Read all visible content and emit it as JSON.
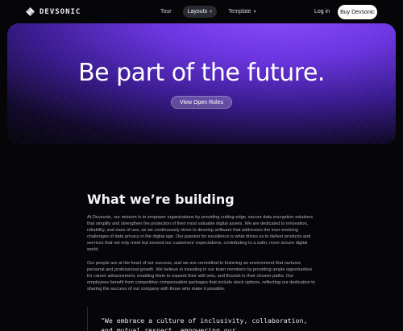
{
  "brand": {
    "name": "DEVSONIC",
    "logo_icon": "pinwheel-logo-icon"
  },
  "nav": {
    "items": [
      {
        "label": "Tour"
      },
      {
        "label": "Layouts",
        "has_dropdown": true,
        "active": true
      },
      {
        "label": "Template",
        "has_dropdown": true
      }
    ],
    "login_label": "Log in",
    "cta_label": "Buy Devsonic"
  },
  "hero": {
    "title": "Be part of the future.",
    "button_label": "View Open Roles",
    "accent_color": "#7b3ff2"
  },
  "section": {
    "title": "What we’re building",
    "paragraphs": [
      "At Devsonic, our mission is to empower organizations by providing cutting-edge, secure data encryption solutions that simplify and strengthen the protection of their most valuable digital assets. We are dedicated to innovation, reliability, and ease of use, as we continuously strive to develop software that addresses the ever-evolving challenges of data privacy in the digital age. Our passion for excellence is what drives us to deliver products and services that not only meet but exceed our customers’ expectations, contributing to a safer, more secure digital world.",
      "Our people are at the heart of our success, and we are committed to fostering an environment that nurtures personal and professional growth. We believe in investing in our team members by providing ample opportunities for career advancement, enabling them to expand their skill sets, and flourish in their chosen paths. Our employees benefit from competitive compensation packages that include stock options, reflecting our dedication to sharing the success of our company with those who make it possible."
    ],
    "quote": "\"We embrace a culture of inclusivity, collaboration, and mutual respect, empowering our"
  }
}
